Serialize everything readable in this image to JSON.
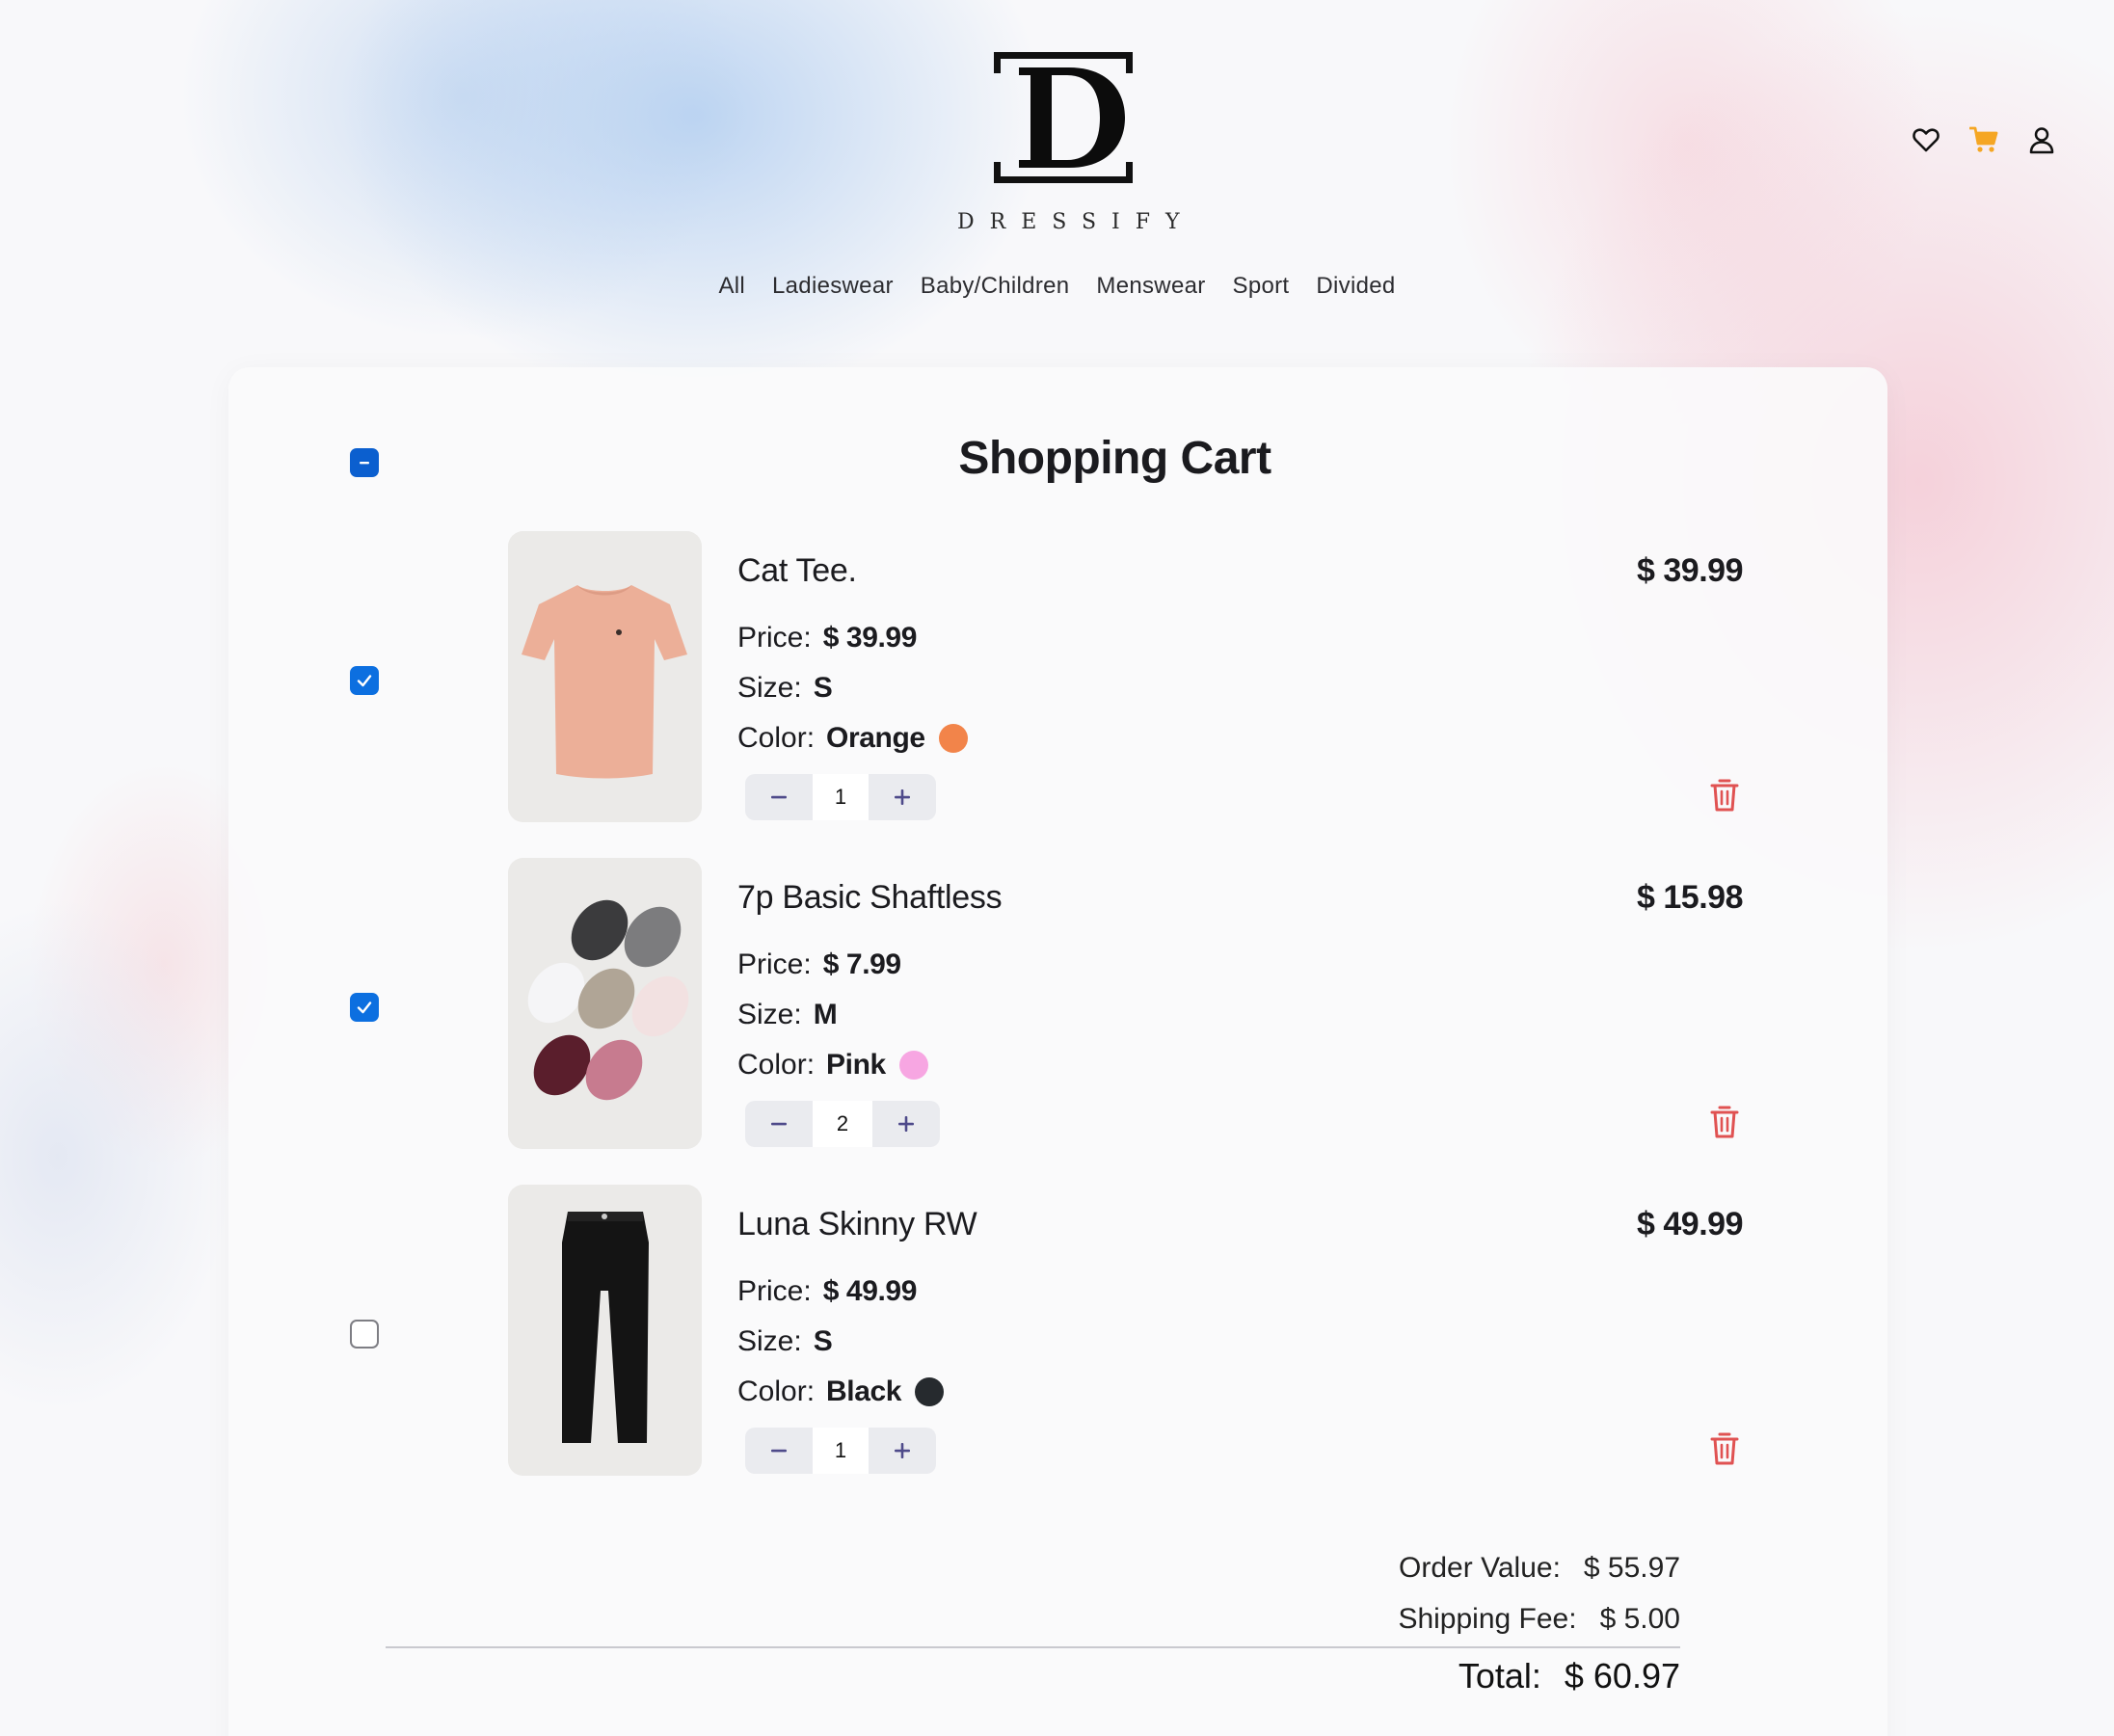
{
  "brand": {
    "name": "DRESSIFY",
    "logo_letter": "D"
  },
  "header": {
    "icons": [
      {
        "name": "wishlist",
        "icon": "heart-icon"
      },
      {
        "name": "cart",
        "icon": "cart-icon",
        "color": "#f5a623"
      },
      {
        "name": "account",
        "icon": "user-icon"
      }
    ]
  },
  "nav": {
    "items": [
      "All",
      "Ladieswear",
      "Baby/Children",
      "Menswear",
      "Sport",
      "Divided"
    ]
  },
  "cart": {
    "title": "Shopping Cart",
    "select_all_state": "indeterminate",
    "price_label": "Price:",
    "size_label": "Size:",
    "color_label": "Color:",
    "items": [
      {
        "name": "Cat Tee.",
        "line_total": "$ 39.99",
        "price": "$ 39.99",
        "size": "S",
        "color": "Orange",
        "swatch": "#f2844a",
        "quantity": "1",
        "selected": true,
        "image": "tshirt"
      },
      {
        "name": "7p Basic Shaftless",
        "line_total": "$ 15.98",
        "price": "$ 7.99",
        "size": "M",
        "color": "Pink",
        "swatch": "#f7a6e2",
        "quantity": "2",
        "selected": true,
        "image": "socks"
      },
      {
        "name": "Luna Skinny RW",
        "line_total": "$ 49.99",
        "price": "$ 49.99",
        "size": "S",
        "color": "Black",
        "swatch": "#262a2e",
        "quantity": "1",
        "selected": false,
        "image": "jeans"
      }
    ]
  },
  "summary": {
    "order_value_label": "Order Value:",
    "order_value": "$ 55.97",
    "shipping_label": "Shipping Fee:",
    "shipping": "$ 5.00",
    "total_label": "Total:",
    "total": "$ 60.97"
  },
  "colors": {
    "accent": "#0c6fe0",
    "delete": "#e05252",
    "cart_icon": "#f5a623",
    "stepper_icon": "#4e4a8a"
  }
}
